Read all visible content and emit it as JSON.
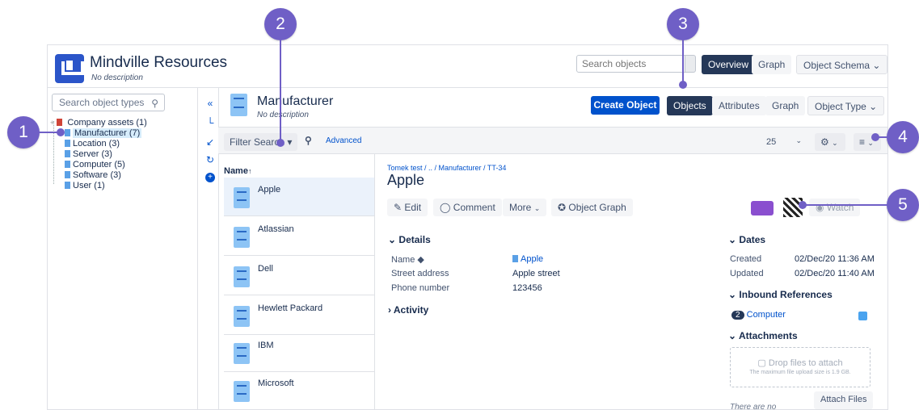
{
  "header": {
    "app_title": "Mindville Resources",
    "app_description": "No description",
    "search_placeholder": "Search objects",
    "tabs": [
      "Overview",
      "Graph"
    ],
    "schema_dropdown": "Object Schema ⌄"
  },
  "sidebar": {
    "search_placeholder": "Search object types",
    "tree": {
      "root": "Company assets (1)",
      "items": [
        "Manufacturer (7)",
        "Location (3)",
        "Server (3)",
        "Computer (5)",
        "Software (3)",
        "User (1)"
      ]
    }
  },
  "object_type": {
    "title": "Manufacturer",
    "description": "No description",
    "create_button": "Create Object",
    "tabs": [
      "Objects",
      "Attributes",
      "Graph"
    ],
    "type_dropdown": "Object Type ⌄"
  },
  "filter": {
    "filter_search": "Filter Search ▾",
    "advanced": "Advanced",
    "page_size": "25"
  },
  "object_list": {
    "column_header": "Name",
    "items": [
      "Apple",
      "Atlassian",
      "Dell",
      "Hewlett Packard",
      "IBM",
      "Microsoft"
    ]
  },
  "detail": {
    "breadcrumb": "Tomek test / .. / Manufacturer / TT-34",
    "title": "Apple",
    "buttons": [
      "Edit",
      "Comment",
      "More",
      "Object Graph"
    ],
    "watch": "Watch",
    "details_header": "Details",
    "fields": [
      {
        "name": "Name",
        "value": "Apple"
      },
      {
        "name": "Street address",
        "value": "Apple street"
      },
      {
        "name": "Phone number",
        "value": "123456"
      }
    ],
    "activity_header": "Activity",
    "dates_header": "Dates",
    "dates": [
      {
        "name": "Created",
        "value": "02/Dec/20 11:36 AM"
      },
      {
        "name": "Updated",
        "value": "02/Dec/20 11:40 AM"
      }
    ],
    "inbound_header": "Inbound References",
    "inbound_count": "2",
    "inbound_label": "Computer",
    "attachments_header": "Attachments",
    "drop_text": "Drop files to attach",
    "drop_subtext": "The maximum file upload size is 1.9 GB.",
    "attach_button": "Attach Files",
    "no_attachments": "There are no"
  },
  "markers": [
    "1",
    "2",
    "3",
    "4",
    "5"
  ],
  "colors": {
    "primary": "#0052cc",
    "dark_nav": "#253858",
    "marker": "#6f5fc6",
    "selected_bg": "#ebf2fb"
  }
}
